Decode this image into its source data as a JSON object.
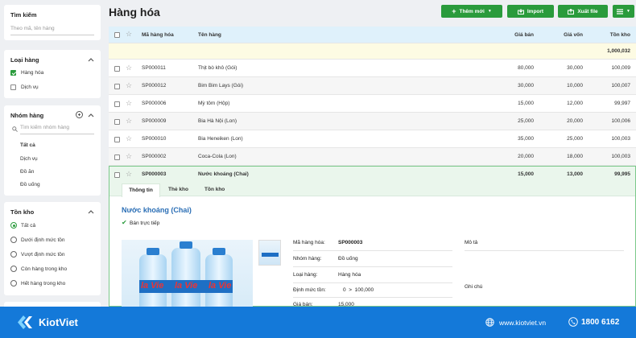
{
  "sidebar": {
    "search": {
      "title": "Tìm kiếm",
      "placeholder": "Theo mã, tên hàng"
    },
    "category": {
      "title": "Loại hàng",
      "items": [
        {
          "label": "Hàng hóa",
          "checked": true
        },
        {
          "label": "Dịch vụ",
          "checked": false
        }
      ]
    },
    "group": {
      "title": "Nhóm hàng",
      "search_placeholder": "Tìm kiếm nhóm hàng",
      "items": [
        {
          "label": "Tất cả",
          "active": true
        },
        {
          "label": "Dịch vụ"
        },
        {
          "label": "Đồ ăn"
        },
        {
          "label": "Đồ uống"
        }
      ]
    },
    "stock": {
      "title": "Tồn kho",
      "items": [
        {
          "label": "Tất cả",
          "selected": true
        },
        {
          "label": "Dưới định mức tồn"
        },
        {
          "label": "Vượt định mức tồn"
        },
        {
          "label": "Còn hàng trong kho"
        },
        {
          "label": "Hết hàng trong kho"
        }
      ]
    }
  },
  "header": {
    "title": "Hàng hóa",
    "add_new": "Thêm mới",
    "import": "Import",
    "export": "Xuất file"
  },
  "table": {
    "columns": {
      "code": "Mã hàng hóa",
      "name": "Tên hàng",
      "price": "Giá bán",
      "cost": "Giá vốn",
      "stock": "Tồn kho"
    },
    "total_stock": "1,000,032",
    "rows": [
      {
        "code": "SP000011",
        "name": "Thịt bò khô (Gói)",
        "price": "80,000",
        "cost": "30,000",
        "stock": "100,009"
      },
      {
        "code": "SP000012",
        "name": "Bim Bim Lays (Gói)",
        "price": "30,000",
        "cost": "10,000",
        "stock": "100,007"
      },
      {
        "code": "SP000006",
        "name": "Mỳ tôm (Hộp)",
        "price": "15,000",
        "cost": "12,000",
        "stock": "99,997"
      },
      {
        "code": "SP000009",
        "name": "Bia Hà Nội (Lon)",
        "price": "25,000",
        "cost": "20,000",
        "stock": "100,006"
      },
      {
        "code": "SP000010",
        "name": "Bia Heneiken (Lon)",
        "price": "35,000",
        "cost": "25,000",
        "stock": "100,003"
      },
      {
        "code": "SP000002",
        "name": "Coca-Cola (Lon)",
        "price": "20,000",
        "cost": "18,000",
        "stock": "100,003"
      }
    ],
    "selected": {
      "code": "SP000003",
      "name": "Nước khoáng (Chai)",
      "price": "15,000",
      "cost": "13,000",
      "stock": "99,995"
    }
  },
  "detail": {
    "tabs": [
      "Thông tin",
      "Thẻ kho",
      "Tồn kho"
    ],
    "title": "Nước khoáng (Chai)",
    "direct_sale": "Bán trực tiếp",
    "image_brand": "la Vie",
    "fields": [
      {
        "label": "Mã hàng hóa:",
        "value": "SP000003"
      },
      {
        "label": "Nhóm hàng:",
        "value": "Đồ uống"
      },
      {
        "label": "Loại hàng:",
        "value": "Hàng hóa"
      },
      {
        "label": "Định mức tồn:",
        "value": "0  >  100,000"
      },
      {
        "label": "Giá bán:",
        "value": "15,000"
      }
    ],
    "description_label": "Mô tả",
    "note_label": "Ghi chú"
  },
  "footer": {
    "brand": "KiotViet",
    "website": "www.kiotviet.vn",
    "phone": "1800 6162"
  },
  "colors": {
    "green": "#2a9b3c",
    "blue": "#1479d9",
    "header_row": "#dff1fb",
    "total_row": "#fdfbe3",
    "detail_title": "#2a6eb5"
  }
}
